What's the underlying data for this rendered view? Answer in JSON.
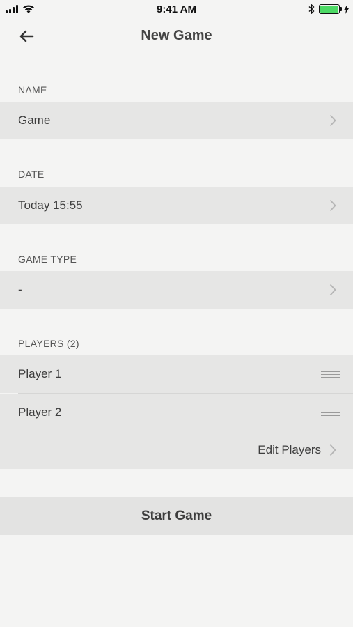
{
  "status_bar": {
    "time": "9:41 AM",
    "signal_icon": "cellular-signal-icon",
    "wifi_icon": "wifi-icon",
    "bluetooth_icon": "bluetooth-icon",
    "battery_icon": "battery-icon",
    "charging_icon": "charging-bolt-icon",
    "battery_level": 1.0,
    "battery_color": "#4cd964"
  },
  "nav": {
    "title": "New Game",
    "back_icon": "back-arrow-icon"
  },
  "form": {
    "name": {
      "header": "NAME",
      "value": "Game"
    },
    "date": {
      "header": "DATE",
      "value": "Today 15:55"
    },
    "game_type": {
      "header": "GAME TYPE",
      "value": "-"
    },
    "players": {
      "header": "PLAYERS (2)",
      "items": [
        {
          "name": "Player 1"
        },
        {
          "name": "Player 2"
        }
      ],
      "edit_label": "Edit Players"
    }
  },
  "actions": {
    "start_label": "Start Game"
  }
}
